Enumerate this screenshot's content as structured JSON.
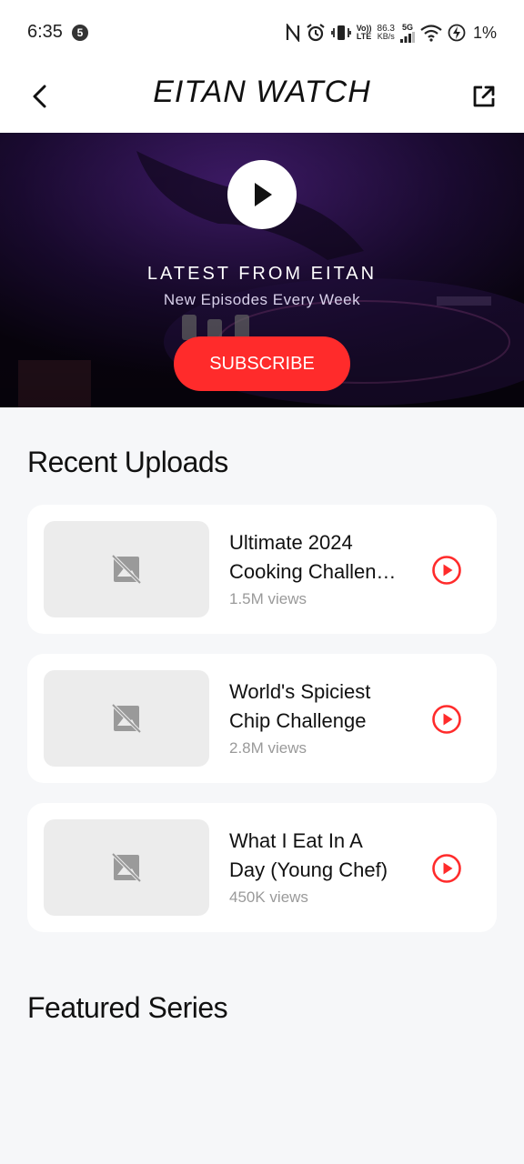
{
  "status_bar": {
    "time": "6:35",
    "notification_count": "5",
    "network_top": "Vo))",
    "network_bottom": "LTE",
    "speed_value": "86.3",
    "speed_unit": "KB/s",
    "signal_label": "5G",
    "battery": "1%"
  },
  "app_bar": {
    "title": "EITAN WATCH"
  },
  "hero": {
    "title": "LATEST FROM EITAN",
    "subtitle": "New Episodes Every Week",
    "subscribe_label": "SUBSCRIBE"
  },
  "recent": {
    "heading": "Recent Uploads",
    "items": [
      {
        "title_line1": "Ultimate 2024",
        "title_line2": "Cooking Challen…",
        "views": "1.5M views"
      },
      {
        "title_line1": "World's Spiciest",
        "title_line2": "Chip Challenge",
        "views": "2.8M views"
      },
      {
        "title_line1": "What I Eat In A",
        "title_line2": "Day (Young Chef)",
        "views": "450K views"
      }
    ]
  },
  "featured": {
    "heading": "Featured Series"
  },
  "colors": {
    "accent": "#ff2b2b",
    "hero_bg": "#1a0b2e",
    "page_bg": "#f6f7f9"
  },
  "icons": {
    "back": "arrow-left-icon",
    "share": "open-external-icon",
    "hero_play": "play-icon",
    "thumbnail": "image-off-icon",
    "item_play": "play-circle-icon"
  }
}
